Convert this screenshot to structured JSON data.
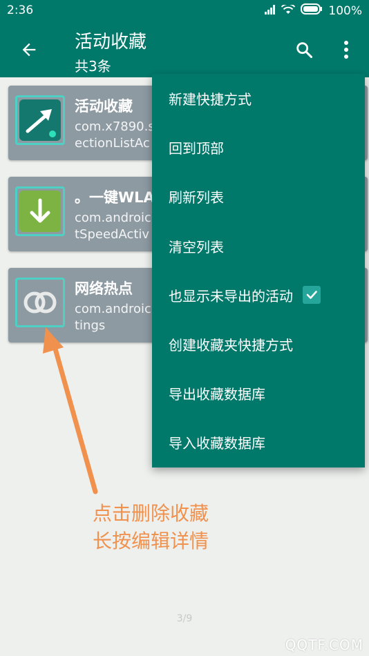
{
  "status_bar": {
    "time": "2:36",
    "battery": "100%"
  },
  "app_bar": {
    "title": "活动收藏",
    "subtitle": "共3条"
  },
  "favorites": [
    {
      "title": "活动收藏",
      "package": "com.x7890.s",
      "activity": "ectionListAc",
      "icon": "shortcut-arrow-icon"
    },
    {
      "title": "。一键WLA",
      "package": "com.androic",
      "activity": "tSpeedActiv",
      "icon": "download-arrow-icon"
    },
    {
      "title": "网络热点",
      "package": "com.androic",
      "activity": "tings",
      "icon": "link-rings-icon"
    }
  ],
  "menu": {
    "items": [
      {
        "label": "新建快捷方式"
      },
      {
        "label": "回到顶部"
      },
      {
        "label": "刷新列表"
      },
      {
        "label": "清空列表"
      },
      {
        "label": "也显示未导出的活动",
        "checked": true
      },
      {
        "label": "创建收藏夹快捷方式"
      },
      {
        "label": "导出收藏数据库"
      },
      {
        "label": "导入收藏数据库"
      }
    ]
  },
  "annotation": {
    "line1": "点击删除收藏",
    "line2": "长按编辑详情"
  },
  "page_indicator": "3/9",
  "watermark": "QQTF.COM",
  "colors": {
    "primary": "#00796b",
    "accent_border": "#4fd0c5",
    "annotation": "#f0914e",
    "card": "#8e9aa2"
  }
}
